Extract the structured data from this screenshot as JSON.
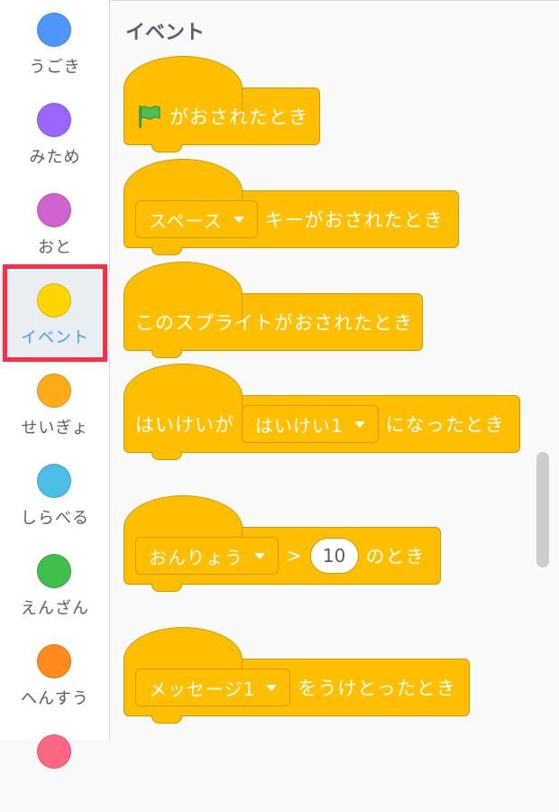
{
  "sidebar": {
    "categories": [
      {
        "label": "うごき",
        "color": "#4c97ff",
        "selected": false
      },
      {
        "label": "みため",
        "color": "#9966ff",
        "selected": false
      },
      {
        "label": "おと",
        "color": "#cf63cf",
        "selected": false
      },
      {
        "label": "イベント",
        "color": "#ffd500",
        "selected": true
      },
      {
        "label": "せいぎょ",
        "color": "#ffab19",
        "selected": false
      },
      {
        "label": "しらべる",
        "color": "#4cbfe6",
        "selected": false
      },
      {
        "label": "えんざん",
        "color": "#40bf4a",
        "selected": false
      },
      {
        "label": "へんすう",
        "color": "#ff8c1a",
        "selected": false
      },
      {
        "label": "",
        "color": "#ff6680",
        "selected": false
      }
    ]
  },
  "palette": {
    "title": "イベント",
    "blocks": {
      "flag": {
        "text": "がおされたとき",
        "icon": "green-flag-icon"
      },
      "key": {
        "dropdown": "スペース",
        "text": "キーがおされたとき"
      },
      "sprite": {
        "text": "このスプライトがおされたとき"
      },
      "backdrop": {
        "text1": "はいけいが",
        "dropdown": "はいけい1",
        "text2": "になったとき"
      },
      "sensor": {
        "dropdown": "おんりょう",
        "op": ">",
        "value": "10",
        "text": "のとき"
      },
      "message": {
        "dropdown": "メッセージ1",
        "text": "をうけとったとき"
      }
    }
  },
  "colors": {
    "event_block": "#ffbf00",
    "highlight": "#ff2d45"
  }
}
